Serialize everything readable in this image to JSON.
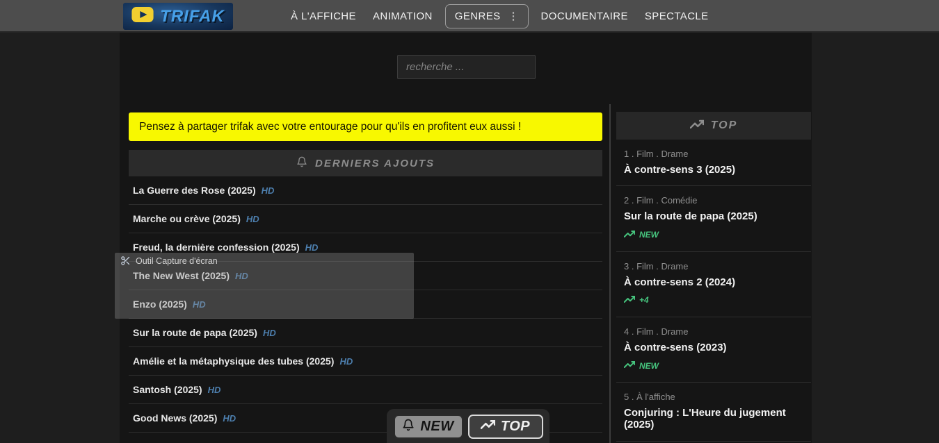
{
  "nav": {
    "logo": "TRIFAK",
    "items": [
      "À L'AFFICHE",
      "ANIMATION",
      "GENRES",
      "DOCUMENTAIRE",
      "SPECTACLE"
    ]
  },
  "search": {
    "placeholder": "recherche ..."
  },
  "banner": {
    "text": "Pensez à partager trifak avec votre entourage pour qu'ils en profitent eux aussi !"
  },
  "latest": {
    "header": "DERNIERS AJOUTS",
    "items": [
      {
        "title": "La Guerre des Rose (2025)",
        "quality": "HD"
      },
      {
        "title": "Marche ou crève (2025)",
        "quality": "HD"
      },
      {
        "title": "Freud, la dernière confession (2025)",
        "quality": "HD"
      },
      {
        "title": "The New West (2025)",
        "quality": "HD"
      },
      {
        "title": "Enzo (2025)",
        "quality": "HD"
      },
      {
        "title": "Sur la route de papa (2025)",
        "quality": "HD"
      },
      {
        "title": "Amélie et la métaphysique des tubes (2025)",
        "quality": "HD"
      },
      {
        "title": "Santosh (2025)",
        "quality": "HD"
      },
      {
        "title": "Good News (2025)",
        "quality": "HD"
      }
    ]
  },
  "top": {
    "header": "TOP",
    "items": [
      {
        "meta": "1 . Film . Drame",
        "title": "À contre-sens 3 (2025)",
        "badge": ""
      },
      {
        "meta": "2 . Film . Comédie",
        "title": "Sur la route de papa (2025)",
        "badge": "NEW"
      },
      {
        "meta": "3 . Film . Drame",
        "title": "À contre-sens 2 (2024)",
        "badge": "+4"
      },
      {
        "meta": "4 . Film . Drame",
        "title": "À contre-sens (2023)",
        "badge": "NEW"
      },
      {
        "meta": "5 . À l'affiche",
        "title": "Conjuring : L'Heure du jugement (2025)",
        "badge": ""
      }
    ]
  },
  "bottom_nav": {
    "new_label": "NEW",
    "top_label": "TOP"
  },
  "overlay": {
    "title": "Outil Capture d'écran"
  },
  "colors": {
    "navbar_gray": "#4d4d4d",
    "banner_yellow": "#f8f800",
    "hd_blue": "#4d7fae",
    "logo_blue": "#47a0e8",
    "trend_green": "#46c37d"
  }
}
